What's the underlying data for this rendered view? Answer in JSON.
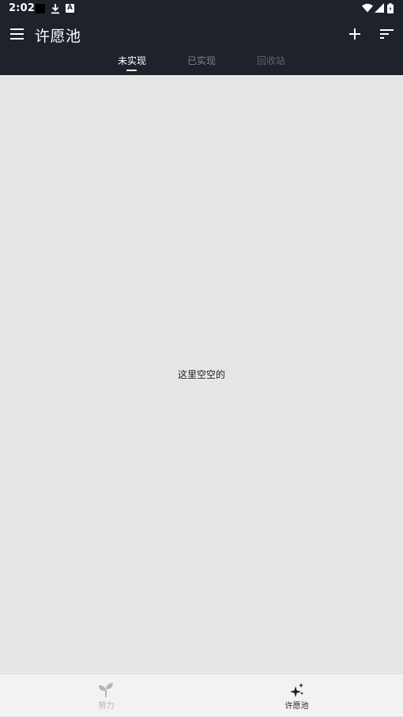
{
  "status_bar": {
    "time": "2:02",
    "a_badge": "A"
  },
  "app_bar": {
    "title": "许愿池",
    "icons": [
      "menu-icon",
      "plus-icon",
      "sort-icon"
    ]
  },
  "tabs": [
    {
      "label": "未实现",
      "active": true
    },
    {
      "label": "已实现",
      "active": false
    },
    {
      "label": "回收站",
      "active": false
    }
  ],
  "main": {
    "empty_message": "这里空空的"
  },
  "bottom_nav": {
    "items": [
      {
        "label": "努力",
        "icon": "sprout-icon",
        "active": false
      },
      {
        "label": "许愿池",
        "icon": "sparkles-icon",
        "active": true
      }
    ]
  },
  "colors": {
    "app_bar_bg": "#1e222a",
    "content_bg": "#e6e6e6",
    "bottom_nav_bg": "#f2f2f2"
  }
}
